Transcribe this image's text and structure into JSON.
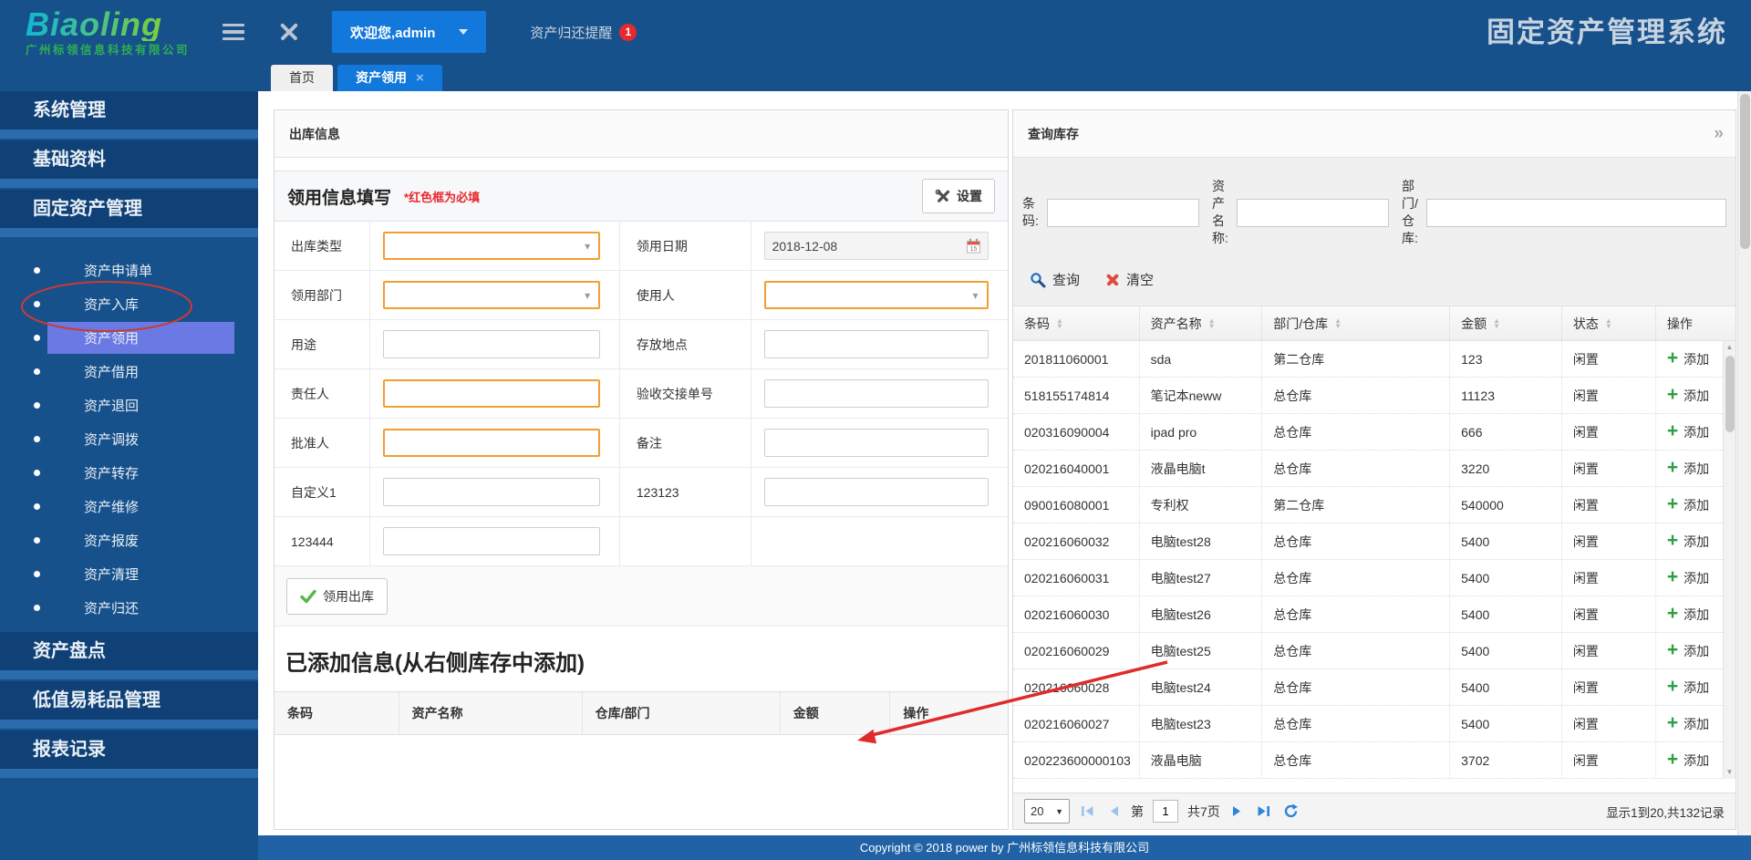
{
  "header": {
    "logo_text": "Biaoling",
    "logo_subtext": "广州标领信息科技有限公司",
    "welcome": "欢迎您,admin",
    "reminder": "资产归还提醒",
    "reminder_count": "1",
    "app_title": "固定资产管理系统"
  },
  "tabs": [
    {
      "label": "首页",
      "active": false
    },
    {
      "label": "资产领用",
      "active": true,
      "closable": true
    }
  ],
  "sidebar": [
    {
      "type": "section",
      "label": "系统管理"
    },
    {
      "type": "section",
      "label": "基础资料"
    },
    {
      "type": "section",
      "label": "固定资产管理"
    },
    {
      "type": "item",
      "label": "资产申请单"
    },
    {
      "type": "item",
      "label": "资产入库"
    },
    {
      "type": "item",
      "label": "资产领用",
      "active": true
    },
    {
      "type": "item",
      "label": "资产借用"
    },
    {
      "type": "item",
      "label": "资产退回"
    },
    {
      "type": "item",
      "label": "资产调拨"
    },
    {
      "type": "item",
      "label": "资产转存"
    },
    {
      "type": "item",
      "label": "资产维修"
    },
    {
      "type": "item",
      "label": "资产报废"
    },
    {
      "type": "item",
      "label": "资产清理"
    },
    {
      "type": "item",
      "label": "资产归还"
    },
    {
      "type": "section",
      "label": "资产盘点"
    },
    {
      "type": "section",
      "label": "低值易耗品管理"
    },
    {
      "type": "section",
      "label": "报表记录"
    }
  ],
  "outbound_panel": {
    "title": "出库信息",
    "form_title": "领用信息填写",
    "required_note": "*红色框为必填",
    "settings_label": "设置",
    "submit_label": "领用出库",
    "added_title": "已添加信息(从右侧库存中添加)",
    "added_columns": [
      "条码",
      "资产名称",
      "仓库/部门",
      "金额",
      "操作"
    ],
    "rows": [
      [
        {
          "label": "出库类型",
          "widget": "select",
          "required": true
        },
        {
          "label": "领用日期",
          "widget": "date",
          "value": "2018-12-08"
        }
      ],
      [
        {
          "label": "领用部门",
          "widget": "select",
          "required": true
        },
        {
          "label": "使用人",
          "widget": "select",
          "required": true
        }
      ],
      [
        {
          "label": "用途",
          "widget": "text"
        },
        {
          "label": "存放地点",
          "widget": "text"
        }
      ],
      [
        {
          "label": "责任人",
          "widget": "text",
          "required": true
        },
        {
          "label": "验收交接单号",
          "widget": "text"
        }
      ],
      [
        {
          "label": "批准人",
          "widget": "text",
          "required": true
        },
        {
          "label": "备注",
          "widget": "text"
        }
      ],
      [
        {
          "label": "自定义1",
          "widget": "text"
        },
        {
          "label": "123123",
          "widget": "text"
        }
      ],
      [
        {
          "label": "123444",
          "widget": "text"
        },
        null
      ]
    ]
  },
  "stock_panel": {
    "title": "查询库存",
    "filters": [
      {
        "label": "条码:"
      },
      {
        "label": "资产名称:"
      },
      {
        "label": "部门/仓库:"
      }
    ],
    "search_label": "查询",
    "clear_label": "清空",
    "add_label": "添加",
    "columns": [
      {
        "label": "条码",
        "sortable": true
      },
      {
        "label": "资产名称",
        "sortable": true
      },
      {
        "label": "部门/仓库",
        "sortable": true
      },
      {
        "label": "金额",
        "sortable": true
      },
      {
        "label": "状态",
        "sortable": true
      },
      {
        "label": "操作",
        "sortable": false
      }
    ],
    "rows": [
      [
        "201811060001",
        "sda",
        "第二仓库",
        "123",
        "闲置"
      ],
      [
        "518155174814",
        "笔记本neww",
        "总仓库",
        "11123",
        "闲置"
      ],
      [
        "020316090004",
        "ipad pro",
        "总仓库",
        "666",
        "闲置"
      ],
      [
        "020216040001",
        "液晶电脑t",
        "总仓库",
        "3220",
        "闲置"
      ],
      [
        "090016080001",
        "专利权",
        "第二仓库",
        "540000",
        "闲置"
      ],
      [
        "020216060032",
        "电脑test28",
        "总仓库",
        "5400",
        "闲置"
      ],
      [
        "020216060031",
        "电脑test27",
        "总仓库",
        "5400",
        "闲置"
      ],
      [
        "020216060030",
        "电脑test26",
        "总仓库",
        "5400",
        "闲置"
      ],
      [
        "020216060029",
        "电脑test25",
        "总仓库",
        "5400",
        "闲置"
      ],
      [
        "020216060028",
        "电脑test24",
        "总仓库",
        "5400",
        "闲置"
      ],
      [
        "020216060027",
        "电脑test23",
        "总仓库",
        "5400",
        "闲置"
      ],
      [
        "020223600000103",
        "液晶电脑",
        "总仓库",
        "3702",
        "闲置"
      ]
    ],
    "pagination": {
      "page_size": "20",
      "page_prefix": "第",
      "current_page": "1",
      "total_pages_label": "共7页",
      "info": "显示1到20,共132记录"
    }
  },
  "footer": {
    "copyright": "Copyright © 2018 power by 广州标领信息科技有限公司"
  }
}
